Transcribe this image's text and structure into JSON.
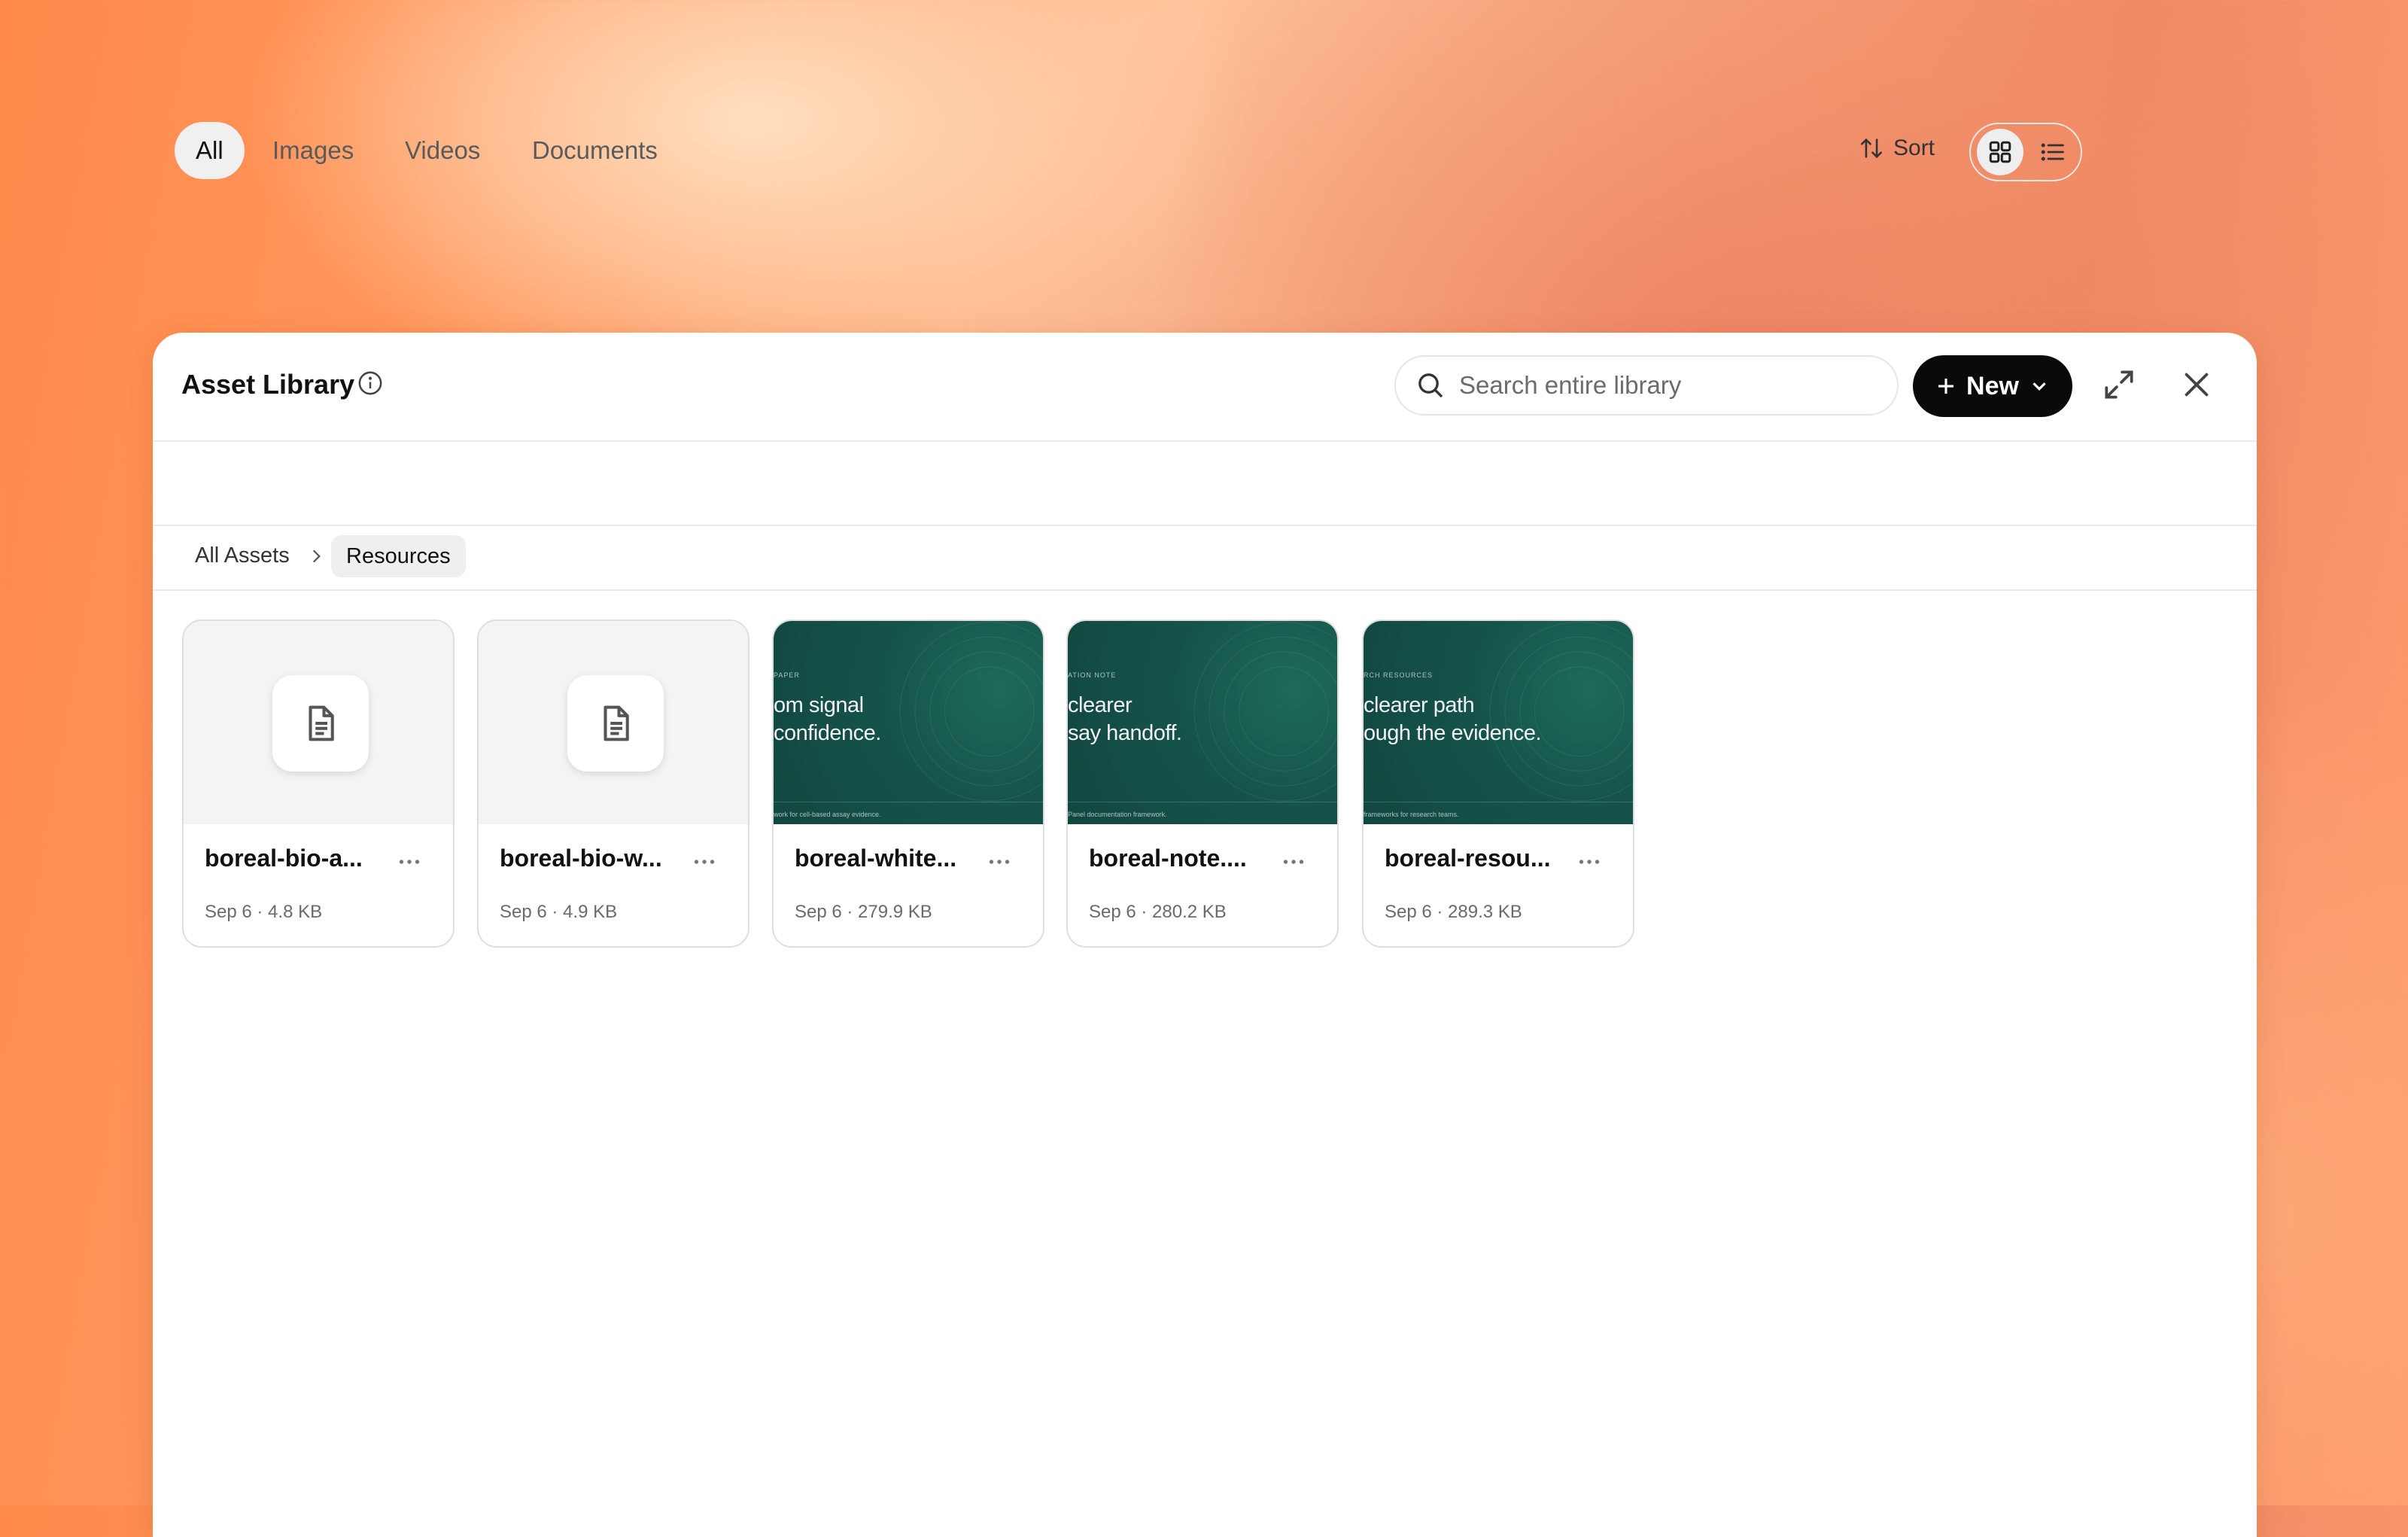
{
  "window": {
    "title": "Asset Library",
    "search_placeholder": "Search entire library",
    "new_button_label": "New"
  },
  "tabs": [
    {
      "label": "All",
      "active": true
    },
    {
      "label": "Images",
      "active": false
    },
    {
      "label": "Videos",
      "active": false
    },
    {
      "label": "Documents",
      "active": false
    }
  ],
  "toolbar": {
    "sort_label": "Sort",
    "view_mode": "grid"
  },
  "breadcrumb": {
    "root": "All Assets",
    "current": "Resources"
  },
  "files": [
    {
      "name": "boreal-bio-a...",
      "meta": "Sep 6 · 4.8 KB",
      "thumb": "document"
    },
    {
      "name": "boreal-bio-w...",
      "meta": "Sep 6 · 4.9 KB",
      "thumb": "document"
    },
    {
      "name": "boreal-white...",
      "meta": "Sep 6 · 279.9 KB",
      "thumb": "image",
      "thumb_kicker": "PAPER",
      "thumb_headline": "om signal\nconfidence.",
      "thumb_footer": "work for cell-based assay evidence."
    },
    {
      "name": "boreal-note....",
      "meta": "Sep 6 · 280.2 KB",
      "thumb": "image",
      "thumb_kicker": "ATION NOTE",
      "thumb_headline": "clearer\nsay handoff.",
      "thumb_footer": "Panel documentation framework."
    },
    {
      "name": "boreal-resou...",
      "meta": "Sep 6 · 289.3 KB",
      "thumb": "image",
      "thumb_kicker": "RCH RESOURCES",
      "thumb_headline": "clearer path\nough the evidence.",
      "thumb_footer": "frameworks for research teams."
    }
  ],
  "colors": {
    "accent": "#0a0a0a",
    "thumb_green": "#15534a"
  }
}
